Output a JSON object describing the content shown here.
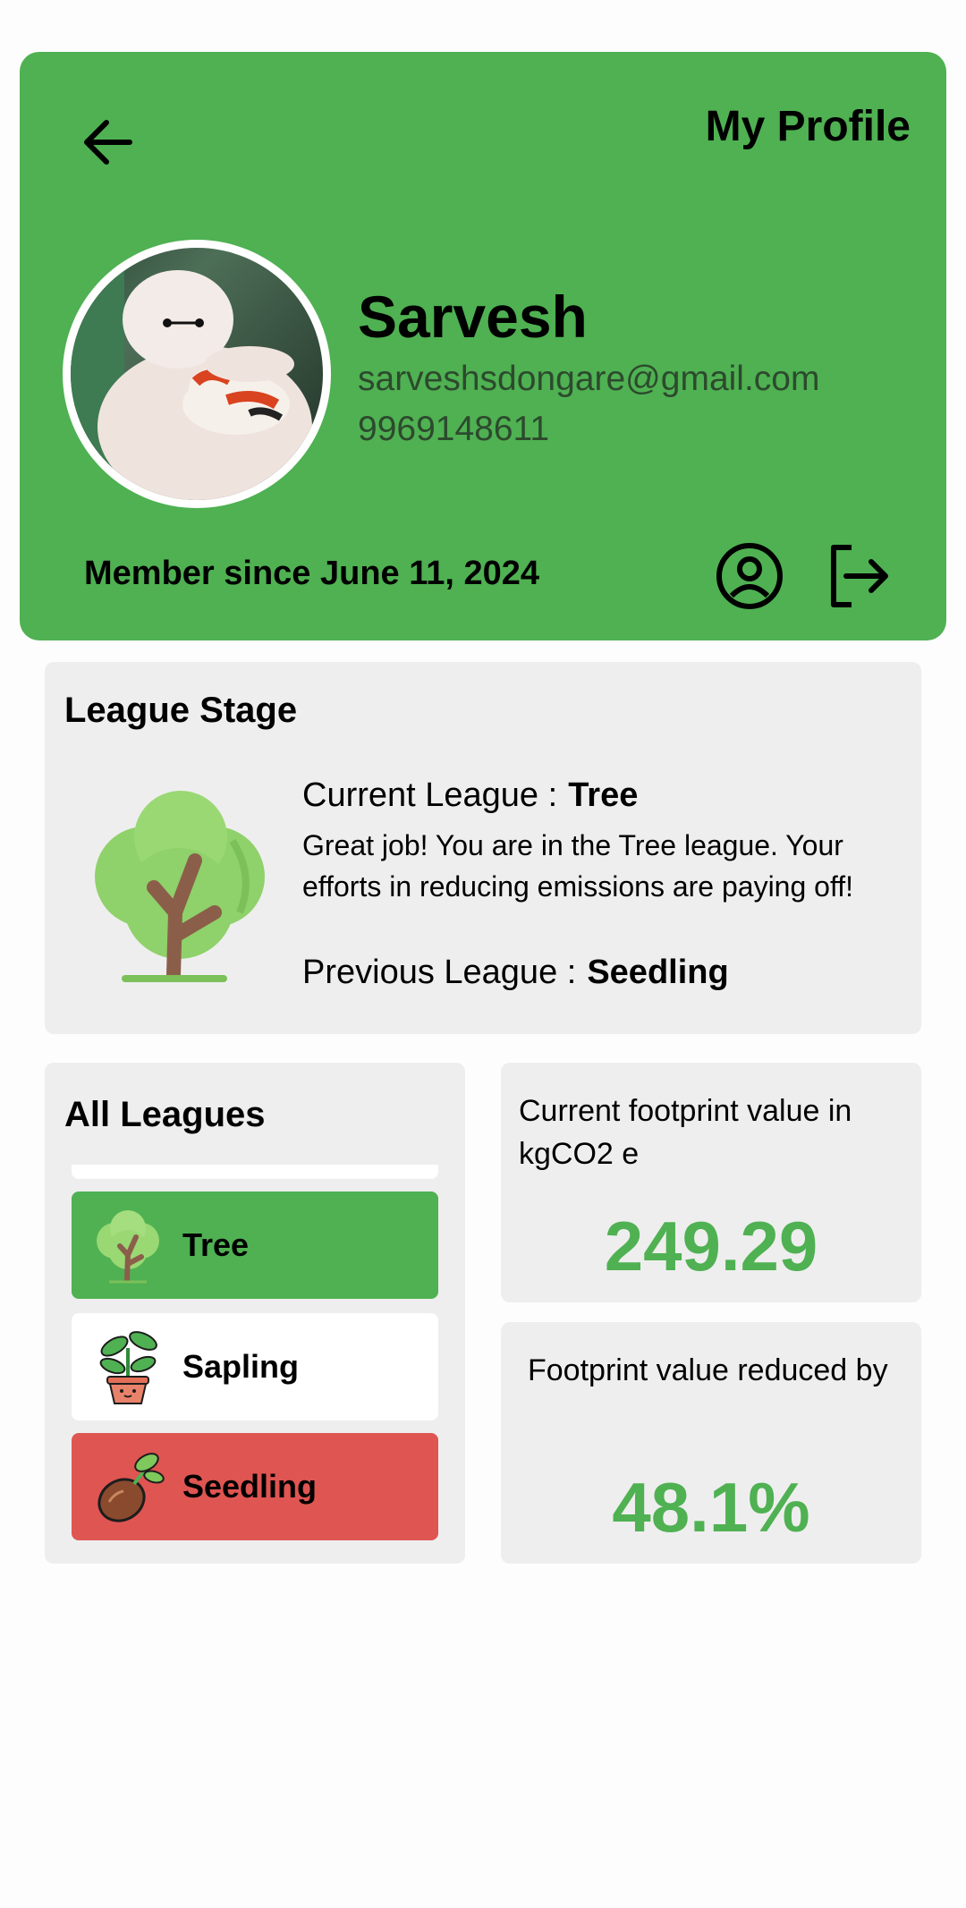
{
  "header": {
    "title": "My Profile",
    "user_name": "Sarvesh",
    "email": "sarveshsdongare@gmail.com",
    "phone": "9969148611",
    "member_since": "Member since June 11, 2024",
    "icons": {
      "back": "arrow-left-icon",
      "profile": "user-circle-icon",
      "logout": "logout-icon"
    }
  },
  "league_stage": {
    "heading": "League Stage",
    "current_label": "Current League :",
    "current_value": "Tree",
    "message": "Great job! You are in the Tree league. Your efforts in reducing emissions are paying off!",
    "previous_label": "Previous League :",
    "previous_value": "Seedling"
  },
  "all_leagues": {
    "heading": "All Leagues",
    "items": [
      {
        "label": "Tree",
        "icon": "tree-icon",
        "state": "current"
      },
      {
        "label": "Sapling",
        "icon": "sapling-icon",
        "state": "locked"
      },
      {
        "label": "Seedling",
        "icon": "seedling-icon",
        "state": "previous"
      }
    ]
  },
  "stats": {
    "footprint_label": "Current footprint value in kgCO2 e",
    "footprint_value": "249.29",
    "reduced_label": "Footprint value reduced by",
    "reduced_value": "48.1%"
  },
  "colors": {
    "brand_green": "#4fb152",
    "card_gray": "#eeeeee",
    "seedling_red": "#df5552"
  }
}
